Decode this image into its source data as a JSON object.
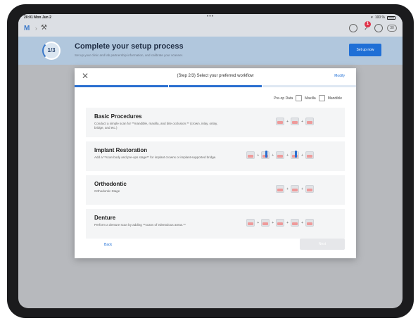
{
  "status_bar": {
    "time": "20:01  Mon Jun 2",
    "battery": "100 %"
  },
  "setup": {
    "progress_label": "1/3",
    "title": "Complete your setup process",
    "subtitle": "Set up your clinic and lab partnership information, and calibrate your scanner.",
    "button_label": "Set up now"
  },
  "header": {
    "notification_count": "1",
    "profile_label": "30"
  },
  "modal": {
    "title": "(Step 2/3) Select your preferred workflow",
    "modify_label": "Modify",
    "preop": {
      "label": "Pre-op Data",
      "maxilla": "Maxilla",
      "mandible": "Mandible"
    },
    "workflows": [
      {
        "title": "Basic Procedures",
        "description": "Conduct a simple scan for **mandible, maxilla, and bite occlusion.** (crown, inlay, onlay, bridge, and etc.)",
        "icons": [
          "tooth",
          "tooth",
          "tooth"
        ]
      },
      {
        "title": "Implant Restoration",
        "description": "Add a **scan body and pre-ops stage** for implant crowns or implant-supported bridge.",
        "icons": [
          "tooth",
          "implant",
          "tooth",
          "implant",
          "tooth"
        ]
      },
      {
        "title": "Orthodontic",
        "description": "Orthodontic Stage",
        "icons": [
          "tooth",
          "tooth",
          "tooth"
        ]
      },
      {
        "title": "Denture",
        "description": "Perform a denture scan by adding **scans of edentulous areas.**",
        "icons": [
          "tooth",
          "tooth",
          "tooth",
          "tooth",
          "tooth"
        ]
      }
    ],
    "back_label": "Back",
    "next_label": "Next"
  }
}
